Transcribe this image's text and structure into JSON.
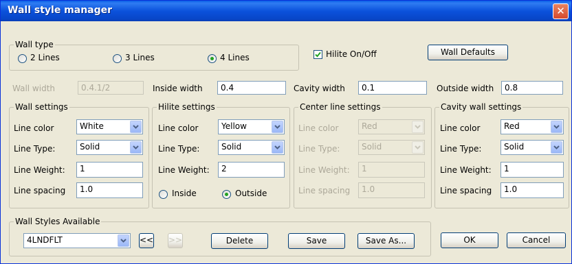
{
  "window": {
    "title": "Wall style manager"
  },
  "wall_type": {
    "legend": "Wall type",
    "options": [
      "2 Lines",
      "3 Lines",
      "4 Lines"
    ],
    "selected": "4 Lines"
  },
  "hilite_toggle": {
    "label": "Hilite On/Off",
    "checked": true
  },
  "wall_defaults_button": "Wall Defaults",
  "widths": {
    "wall_width": {
      "label": "Wall width",
      "value": "0.4.1/2",
      "enabled": false
    },
    "inside_width": {
      "label": "Inside width",
      "value": "0.4"
    },
    "cavity_width": {
      "label": "Cavity width",
      "value": "0.1"
    },
    "outside_width": {
      "label": "Outside width",
      "value": "0.8"
    }
  },
  "labels": {
    "line_color": "Line color",
    "line_type": "Line Type:",
    "line_weight": "Line Weight:",
    "line_spacing": "Line spacing"
  },
  "wall_settings": {
    "legend": "Wall settings",
    "line_color": "White",
    "line_type": "Solid",
    "line_weight": "1",
    "line_spacing": "1.0"
  },
  "hilite_settings": {
    "legend": "Hilite settings",
    "line_color": "Yellow",
    "line_type": "Solid",
    "line_weight": "2",
    "position_options": [
      "Inside",
      "Outside"
    ],
    "position_selected": "Outside"
  },
  "center_line_settings": {
    "legend": "Center line settings",
    "line_color": "Red",
    "line_type": "Solid",
    "line_weight": "1",
    "line_spacing": "1.0",
    "enabled": false
  },
  "cavity_wall_settings": {
    "legend": "Cavity wall settings",
    "line_color": "Red",
    "line_type": "Solid",
    "line_weight": "1",
    "line_spacing": "1.0"
  },
  "wall_styles": {
    "legend": "Wall Styles Available",
    "selected": "4LNDFLT",
    "prev_label": "<<",
    "next_label": ">>",
    "delete_label": "Delete",
    "save_label": "Save",
    "save_as_label": "Save As..."
  },
  "dialog_buttons": {
    "ok": "OK",
    "cancel": "Cancel"
  },
  "colors": {
    "title_bar": "#0a56e0",
    "dialog_bg": "#ece9d8",
    "close_button": "#d6492d"
  }
}
